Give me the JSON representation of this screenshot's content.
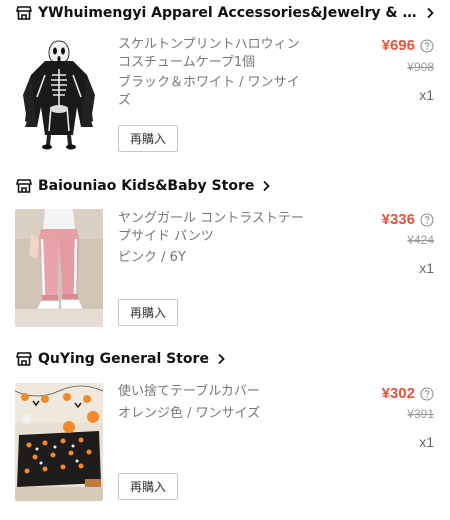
{
  "orders": [
    {
      "store": "YWhuimengyi Apparel Accessories&Jewelry & Watc...",
      "title": "スケルトンプリントハロウィンコスチュームケープ1個",
      "variant": "ブラック＆ホワイト / ワンサイズ",
      "price": "¥696",
      "original_price": "¥908",
      "quantity": "x1",
      "rebuy_label": "再購入",
      "image": "skeleton-ghost-costume"
    },
    {
      "store": "Baiouniao Kids&Baby Store",
      "title": "ヤングガール コントラストテープサイド パンツ",
      "variant": "ピンク / 6Y",
      "price": "¥336",
      "original_price": "¥424",
      "quantity": "x1",
      "rebuy_label": "再購入",
      "image": "pink-track-pants"
    },
    {
      "store": "QuYing General Store",
      "title": "使い捨てテーブルカバー",
      "variant": "オレンジ色 / ワンサイズ",
      "price": "¥302",
      "original_price": "¥391",
      "quantity": "x1",
      "rebuy_label": "再購入",
      "image": "halloween-tablecloth"
    }
  ],
  "colors": {
    "price": "#e5533a",
    "muted": "#777777",
    "strike": "#999999"
  }
}
